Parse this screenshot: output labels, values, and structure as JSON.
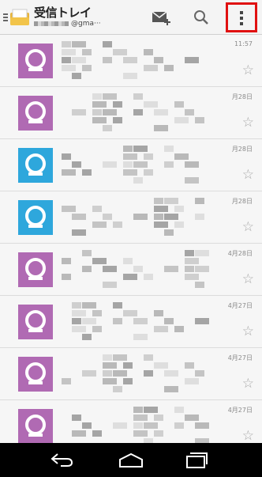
{
  "header": {
    "title": "受信トレイ",
    "account_suffix": "@gma···"
  },
  "colors": {
    "avatar_purple": "#b06ab3",
    "avatar_blue": "#2ea7dc",
    "highlight": "#e01010"
  },
  "messages": [
    {
      "time": "11:57",
      "avatar": "purple"
    },
    {
      "time": "月28日",
      "avatar": "purple"
    },
    {
      "time": "月28日",
      "avatar": "blue"
    },
    {
      "time": "月28日",
      "avatar": "blue"
    },
    {
      "time": "4月28日",
      "avatar": "purple"
    },
    {
      "time": "4月27日",
      "avatar": "purple"
    },
    {
      "time": "4月27日",
      "avatar": "purple"
    },
    {
      "time": "4月27日",
      "avatar": "purple"
    }
  ],
  "star_glyph": "☆",
  "icons": {
    "drawer": "menu-lines-icon",
    "app": "inbox-icon",
    "compose": "compose-icon",
    "search": "search-icon",
    "overflow": "overflow-menu-icon",
    "back": "back-icon",
    "home": "home-icon",
    "recents": "recents-icon"
  }
}
